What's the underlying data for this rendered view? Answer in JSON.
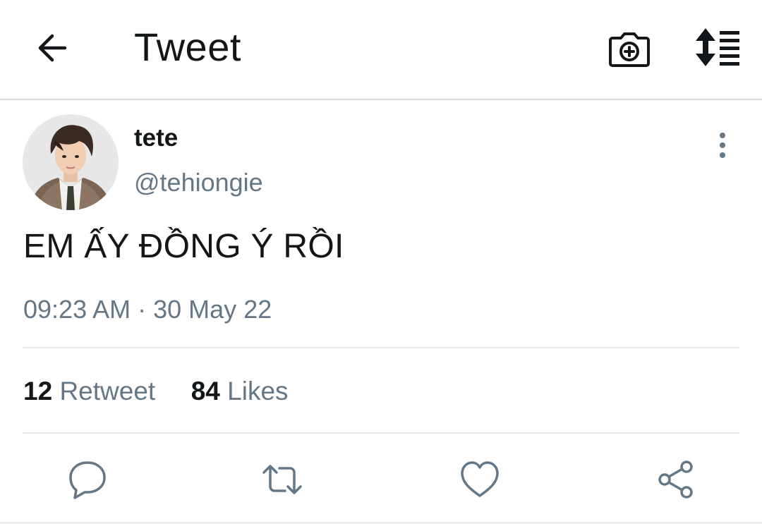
{
  "header": {
    "title": "Tweet",
    "back_icon": "arrow-left-icon",
    "camera_icon": "camera-plus-icon",
    "sort_icon": "sort-list-icon"
  },
  "tweet": {
    "display_name": "tete",
    "handle": "@tehiongie",
    "text": "EM ẤY ĐỒNG Ý RỒI",
    "time": "09:23 AM",
    "separator": "·",
    "date": "30 May 22",
    "stats": {
      "retweets_count": "12",
      "retweets_label": "Retweet",
      "likes_count": "84",
      "likes_label": "Likes"
    }
  },
  "actions": [
    {
      "icon": "reply-icon"
    },
    {
      "icon": "retweet-icon"
    },
    {
      "icon": "like-heart-icon"
    },
    {
      "icon": "share-icon"
    }
  ],
  "colors": {
    "text_primary": "#14171a",
    "text_secondary": "#657786",
    "divider": "#e6ecf0",
    "icon": "#657786"
  }
}
